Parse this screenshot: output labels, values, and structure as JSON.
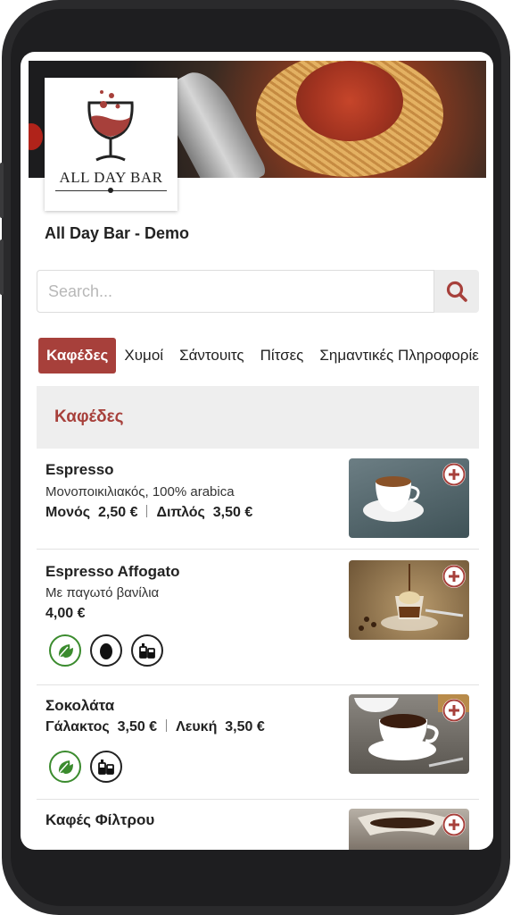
{
  "restaurant": {
    "name": "All Day Bar - Demo",
    "logo_text": "ALL DAY BAR"
  },
  "search": {
    "placeholder": "Search..."
  },
  "tabs": [
    {
      "label": "Καφέδες",
      "active": true
    },
    {
      "label": "Χυμοί"
    },
    {
      "label": "Σάντουιτς"
    },
    {
      "label": "Πίτσες"
    },
    {
      "label": "Σημαντικές Πληροφορίες"
    }
  ],
  "section": {
    "title": "Καφέδες"
  },
  "items": [
    {
      "name": "Espresso",
      "description": "Μονοποικιλιακός, 100% arabica",
      "prices": [
        {
          "label": "Μονός",
          "value": "2,50 €"
        },
        {
          "label": "Διπλός",
          "value": "3,50 €"
        }
      ],
      "badges": [],
      "image": "espresso-cup-photo"
    },
    {
      "name": "Espresso Affogato",
      "description": "Με παγωτό βανίλια",
      "price": "4,00 €",
      "badges": [
        "vegetarian-leaf-icon",
        "egg-icon",
        "dairy-bottles-icon"
      ],
      "image": "affogato-glass-photo"
    },
    {
      "name": "Σοκολάτα",
      "prices": [
        {
          "label": "Γάλακτος",
          "value": "3,50 €"
        },
        {
          "label": "Λευκή",
          "value": "3,50 €"
        }
      ],
      "badges": [
        "vegetarian-leaf-icon",
        "dairy-bottles-icon"
      ],
      "image": "hot-chocolate-cup-photo"
    },
    {
      "name": "Καφές Φίλτρου",
      "image": "filter-coffee-photo"
    }
  ],
  "colors": {
    "accent": "#a7403b",
    "badge_green": "#3b8b2e",
    "section_bg": "#eeeeee"
  }
}
